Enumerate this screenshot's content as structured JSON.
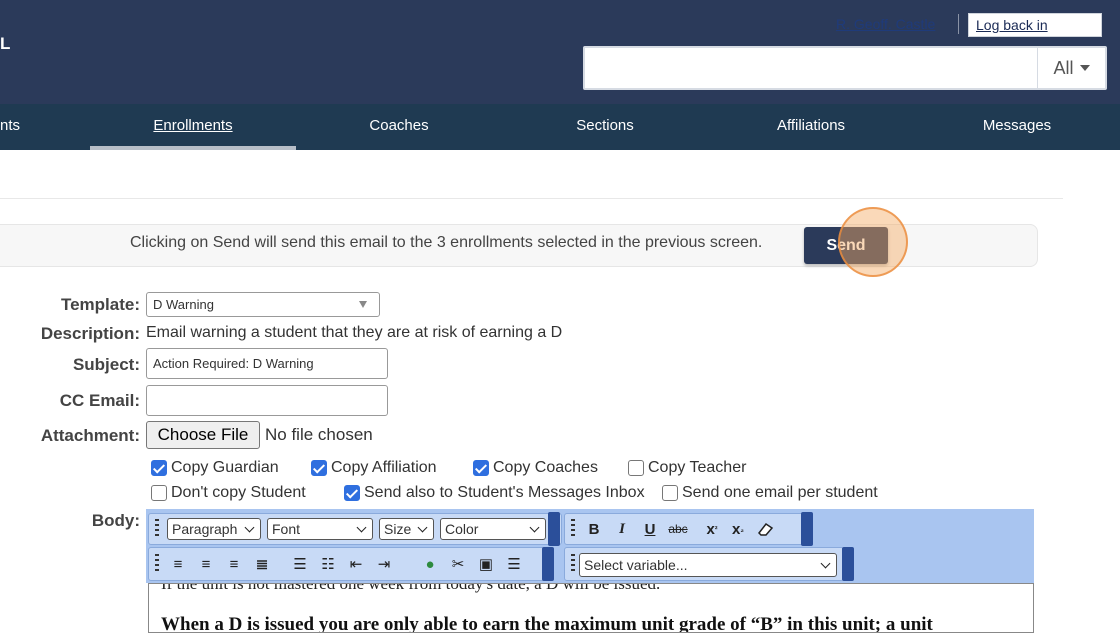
{
  "header": {
    "brand": "L",
    "user_link": "R. Geoff. Castle",
    "log_back_in": "Log back in",
    "search_placeholder": "",
    "search_scope": "All"
  },
  "nav": {
    "items": [
      "nts",
      "Enrollments",
      "Coaches",
      "Sections",
      "Affiliations",
      "Messages"
    ],
    "active": "Enrollments"
  },
  "notice": {
    "text": "Clicking on Send will send this email to the 3 enrollments selected in the previous screen.",
    "send_label": "Send"
  },
  "form": {
    "template_label": "Template:",
    "template_value": "D Warning",
    "description_label": "Description:",
    "description_value": "Email warning a student that they are at risk of earning a D",
    "subject_label": "Subject:",
    "subject_value": "Action Required: D Warning",
    "cc_label": "CC Email:",
    "cc_value": "",
    "attachment_label": "Attachment:",
    "choose_file": "Choose File",
    "no_file": "No file chosen",
    "body_label": "Body:"
  },
  "options": {
    "copy_guardian": "Copy Guardian",
    "copy_affiliation": "Copy Affiliation",
    "copy_coaches": "Copy Coaches",
    "copy_teacher": "Copy Teacher",
    "dont_copy_student": "Don't copy Student",
    "send_messages_inbox": "Send also to Student's Messages Inbox",
    "send_one_per_student": "Send one email per student",
    "checked": {
      "copy_guardian": true,
      "copy_affiliation": true,
      "copy_coaches": true,
      "copy_teacher": false,
      "dont_copy_student": false,
      "send_messages_inbox": true,
      "send_one_per_student": false
    }
  },
  "editor": {
    "format": "Paragraph",
    "font": "Font",
    "size": "Size",
    "color": "Color",
    "variable": "Select variable...",
    "bold": "B",
    "italic": "I",
    "underline": "U",
    "strike": "abc",
    "body_line1": "If the unit is not mastered one week from today's date, a D will be issued.",
    "body_line2": "When a D is issued you are only able to earn the maximum unit grade of “B” in this unit; a unit"
  },
  "colors": {
    "header_bg": "#2b3a5a",
    "nav_bg": "#1f3a52",
    "send_bg": "#2b3a5a",
    "checkbox_on": "#2f6fdf",
    "toolbar_bg": "#a9c5f0"
  }
}
